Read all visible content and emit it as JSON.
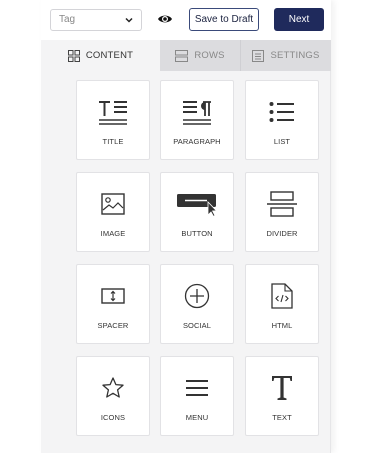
{
  "toolbar": {
    "tag_placeholder": "Tag",
    "save_label": "Save to Draft",
    "next_label": "Next"
  },
  "tabs": [
    {
      "label": "CONTENT",
      "icon": "grid-icon",
      "active": true
    },
    {
      "label": "ROWS",
      "icon": "rows-icon",
      "active": false
    },
    {
      "label": "SETTINGS",
      "icon": "settings-icon",
      "active": false
    }
  ],
  "blocks": [
    {
      "label": "TITLE",
      "icon": "title-icon"
    },
    {
      "label": "PARAGRAPH",
      "icon": "paragraph-icon"
    },
    {
      "label": "LIST",
      "icon": "list-icon"
    },
    {
      "label": "IMAGE",
      "icon": "image-icon"
    },
    {
      "label": "BUTTON",
      "icon": "button-icon"
    },
    {
      "label": "DIVIDER",
      "icon": "divider-icon"
    },
    {
      "label": "SPACER",
      "icon": "spacer-icon"
    },
    {
      "label": "SOCIAL",
      "icon": "social-icon"
    },
    {
      "label": "HTML",
      "icon": "html-icon"
    },
    {
      "label": "ICONS",
      "icon": "star-icon"
    },
    {
      "label": "MENU",
      "icon": "menu-icon"
    },
    {
      "label": "TEXT",
      "icon": "text-icon"
    }
  ],
  "colors": {
    "primary": "#1f2a5c",
    "icon": "#333333"
  }
}
